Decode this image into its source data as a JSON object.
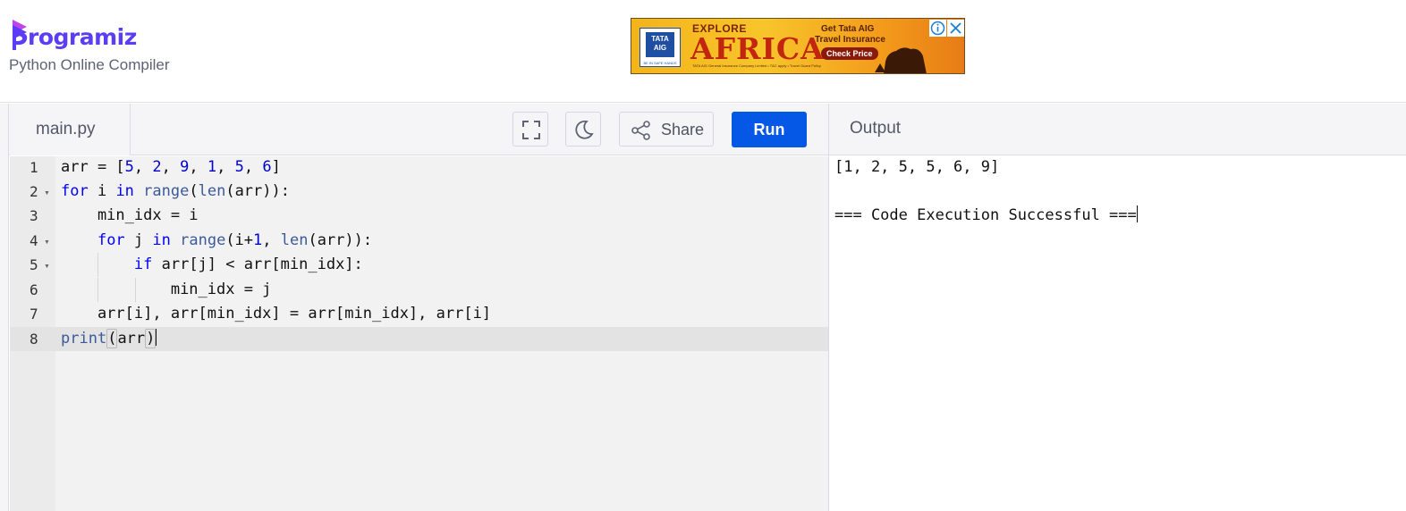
{
  "header": {
    "logo_text": "rogramiz",
    "logo_letter": "P",
    "subtitle": "Python Online Compiler"
  },
  "ad": {
    "brand": "TATA AIG",
    "brand_tag": "BE IN SAFE HANDS",
    "headline_top": "EXPLORE",
    "headline": "AFRICA",
    "offer_line1": "Get Tata AIG",
    "offer_line2": "Travel Insurance",
    "cta": "Check Price",
    "fine_print": "TATA AIG General Insurance Company Limited • T&C apply • Travel Guard Policy"
  },
  "editor": {
    "file_name": "main.py",
    "share_label": "Share",
    "run_label": "Run",
    "lines": [
      {
        "number": "1"
      },
      {
        "number": "2"
      },
      {
        "number": "3"
      },
      {
        "number": "4"
      },
      {
        "number": "5"
      },
      {
        "number": "6"
      },
      {
        "number": "7"
      },
      {
        "number": "8"
      }
    ],
    "code": {
      "l1_a": "arr = [",
      "l1_n1": "5",
      "l1_n2": "2",
      "l1_n3": "9",
      "l1_n4": "1",
      "l1_n5": "5",
      "l1_n6": "6",
      "l2_kw1": "for",
      "l2_a": " i ",
      "l2_kw2": "in",
      "l2_fn1": "range",
      "l2_b": "(",
      "l2_fn2": "len",
      "l2_c": "(arr)):",
      "l3": "    min_idx = i",
      "l4_kw1": "for",
      "l4_a": " j ",
      "l4_kw2": "in",
      "l4_fn1": "range",
      "l4_b": "(i+",
      "l4_n": "1",
      "l4_c": ", ",
      "l4_fn2": "len",
      "l4_d": "(arr)):",
      "l5_kw": "if",
      "l5_a": " arr[j] < arr[min_idx]:",
      "l6": "min_idx = j",
      "l7": "    arr[i], arr[min_idx] = arr[min_idx], arr[i]",
      "l8_fn": "print",
      "l8_open": "(",
      "l8_arg": "arr",
      "l8_close": ")"
    }
  },
  "output": {
    "title": "Output",
    "lines": [
      "[1, 2, 5, 5, 6, 9]",
      "=== Code Execution Successful ==="
    ]
  },
  "colors": {
    "brand_purple": "#5b3df5",
    "run_blue": "#0557e6",
    "keyword_blue": "#0000ff"
  }
}
